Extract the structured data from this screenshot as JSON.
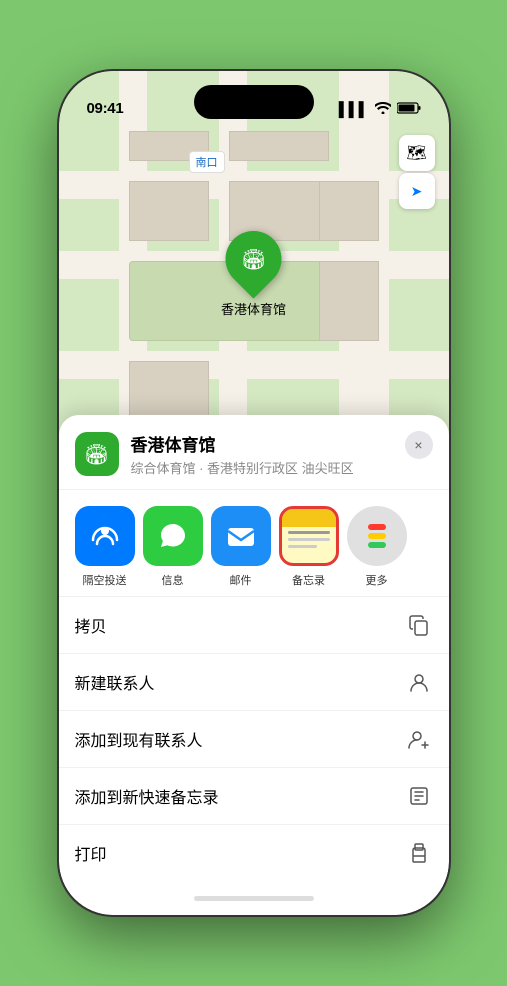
{
  "status_bar": {
    "time": "09:41",
    "signal": "▌▌▌",
    "wifi": "wifi",
    "battery": "battery"
  },
  "map": {
    "label_text": "南口",
    "pin_label": "香港体育馆",
    "controls": {
      "map_icon": "🗺",
      "location_icon": "➤"
    }
  },
  "sheet": {
    "venue_name": "香港体育馆",
    "venue_desc": "综合体育馆 · 香港特别行政区 油尖旺区",
    "close_label": "×",
    "share_items": [
      {
        "id": "airdrop",
        "label": "隔空投送"
      },
      {
        "id": "message",
        "label": "信息"
      },
      {
        "id": "mail",
        "label": "邮件"
      },
      {
        "id": "notes",
        "label": "备忘录"
      },
      {
        "id": "more",
        "label": "更多"
      }
    ],
    "actions": [
      {
        "id": "copy",
        "label": "拷贝",
        "icon": "copy"
      },
      {
        "id": "new-contact",
        "label": "新建联系人",
        "icon": "person"
      },
      {
        "id": "add-contact",
        "label": "添加到现有联系人",
        "icon": "person-add"
      },
      {
        "id": "add-note",
        "label": "添加到新快速备忘录",
        "icon": "note"
      },
      {
        "id": "print",
        "label": "打印",
        "icon": "print"
      }
    ]
  }
}
